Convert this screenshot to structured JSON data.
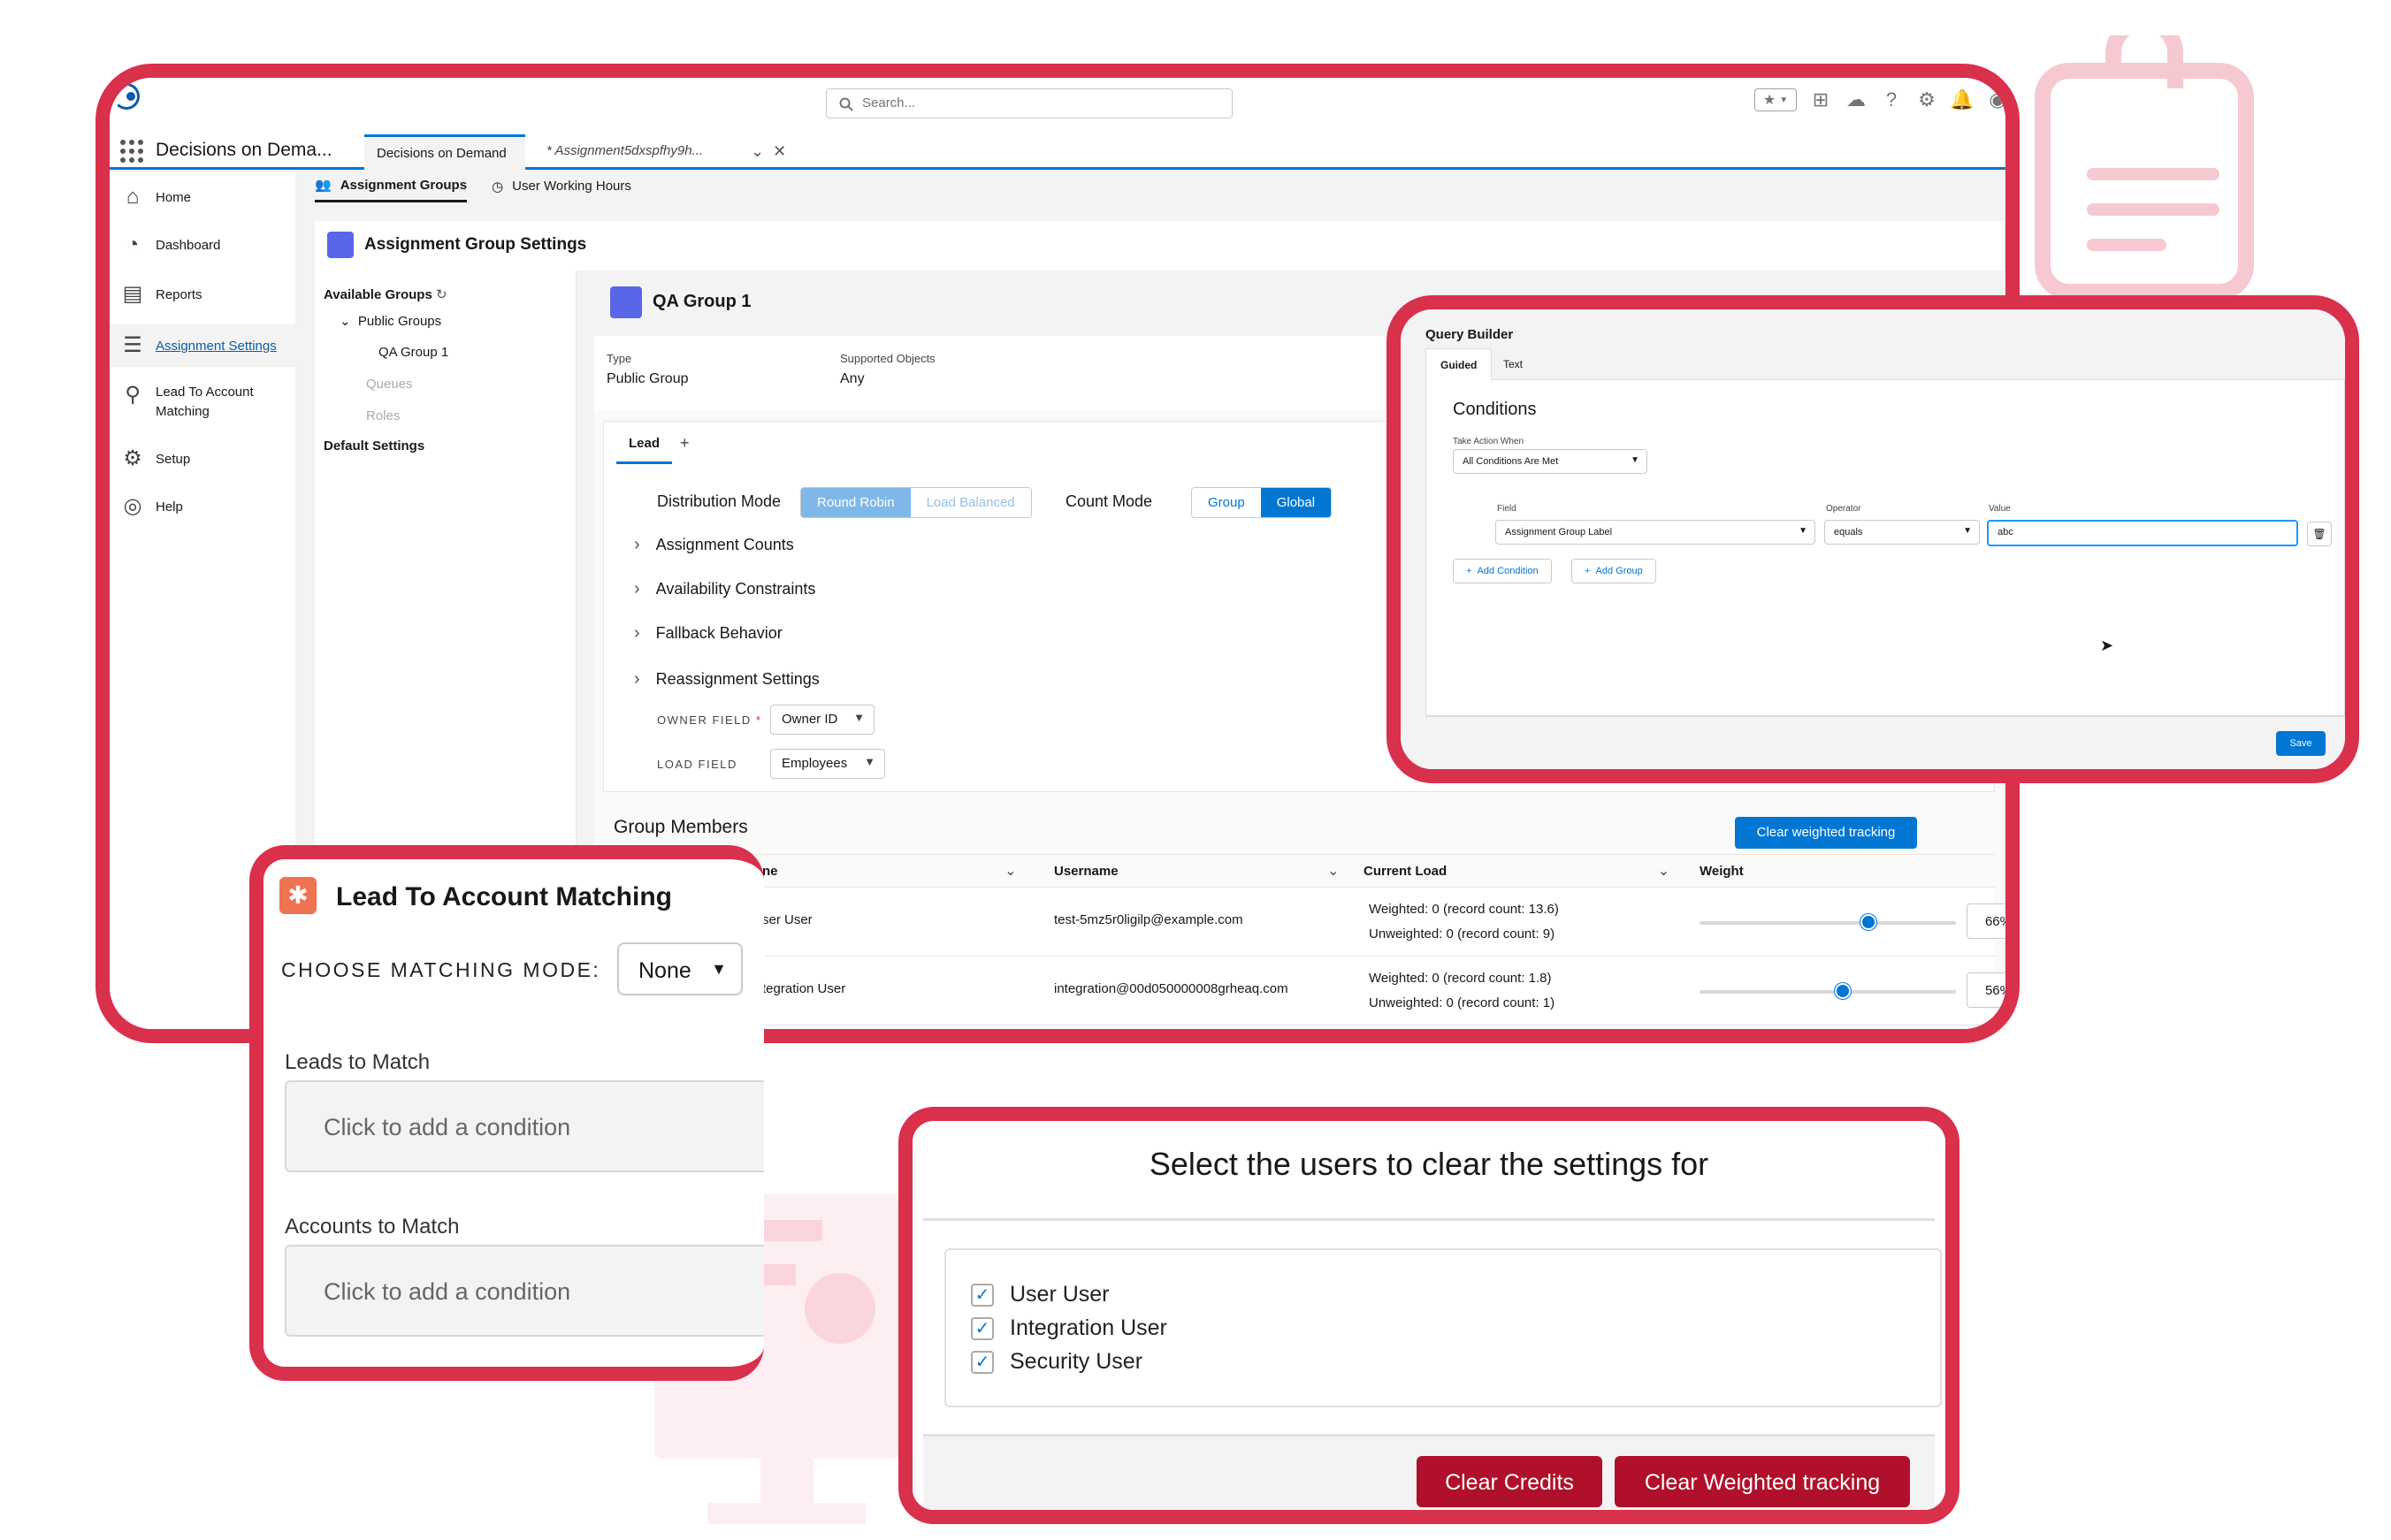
{
  "main": {
    "search_placeholder": "Search...",
    "app_name": "Decisions on Dema...",
    "tabs": [
      {
        "label": "Decisions on Demand"
      },
      {
        "label": "* Assignment5dxspfhy9h..."
      }
    ],
    "sidebar": [
      {
        "label": "Home",
        "icon": "home-icon"
      },
      {
        "label": "Dashboard",
        "icon": "dashboard-icon"
      },
      {
        "label": "Reports",
        "icon": "reports-icon"
      },
      {
        "label": "Assignment Settings",
        "icon": "settings-lines-icon"
      },
      {
        "label": "Lead To Account Matching",
        "icon": "person-match-icon"
      },
      {
        "label": "Setup",
        "icon": "gear-icon"
      },
      {
        "label": "Help",
        "icon": "help-icon"
      }
    ],
    "sub_tabs": [
      {
        "label": "Assignment Groups"
      },
      {
        "label": "User Working Hours"
      }
    ],
    "settings_title": "Assignment Group Settings",
    "groups_panel": {
      "available_groups": "Available Groups",
      "public_groups": "Public Groups",
      "qa_group": "QA Group 1",
      "queues": "Queues",
      "roles": "Roles",
      "default_settings": "Default Settings"
    },
    "detail": {
      "group_name": "QA Group 1",
      "type_label": "Type",
      "type_value": "Public Group",
      "objects_label": "Supported Objects",
      "objects_value": "Any",
      "lead_tab": "Lead",
      "plus_tab": "+",
      "distribution_mode_label": "Distribution Mode",
      "round_robin": "Round Robin",
      "load_balanced": "Load Balanced",
      "count_mode_label": "Count Mode",
      "group": "Group",
      "global": "Global",
      "sections": [
        "Assignment Counts",
        "Availability Constraints",
        "Fallback Behavior",
        "Reassignment Settings"
      ],
      "owner_field_label": "OWNER FIELD",
      "owner_field_required": "*",
      "owner_field_value": "Owner ID",
      "load_field_label": "LOAD FIELD",
      "load_field_value": "Employees"
    },
    "members": {
      "title": "Group Members",
      "clear_button": "Clear weighted tracking",
      "columns": [
        "ne",
        "Username",
        "Current Load",
        "Weight"
      ],
      "rows": [
        {
          "name": "ser User",
          "username": "test-5mz5r0ligilp@example.com",
          "weighted": "Weighted: 0 (record count: 13.6)",
          "unweighted": "Unweighted: 0 (record count: 9)",
          "weight": 0.66,
          "weight_label": "66%"
        },
        {
          "name": "tegration User",
          "username": "integration@00d050000008grheaq.com",
          "weighted": "Weighted: 0 (record count: 1.8)",
          "unweighted": "Unweighted: 0 (record count: 1)",
          "weight": 0.56,
          "weight_label": "56%"
        }
      ]
    }
  },
  "query_builder": {
    "title": "Query Builder",
    "tabs": [
      "Guided",
      "Text"
    ],
    "conditions_title": "Conditions",
    "take_action_label": "Take Action When",
    "take_action_value": "All Conditions Are Met",
    "field_label": "Field",
    "field_value": "Assignment Group Label",
    "operator_label": "Operator",
    "operator_value": "equals",
    "value_label": "Value",
    "value_value": "abc",
    "add_condition": "Add Condition",
    "add_group": "Add Group",
    "save": "Save"
  },
  "lead_matching": {
    "title": "Lead To Account Matching",
    "mode_label": "CHOOSE MATCHING MODE:",
    "mode_value": "None",
    "leads_label": "Leads to Match",
    "leads_placeholder": "Click to add a condition",
    "accounts_label": "Accounts to Match",
    "accounts_placeholder": "Click to add a condition"
  },
  "clear_settings": {
    "title": "Select the users to clear the settings for",
    "users": [
      {
        "label": "User User",
        "checked": true
      },
      {
        "label": "Integration User",
        "checked": true
      },
      {
        "label": "Security User",
        "checked": true
      }
    ],
    "clear_credits": "Clear Credits",
    "clear_weighted": "Clear Weighted tracking"
  },
  "colors": {
    "frame": "#d9304c",
    "brand_blue": "#0176d3",
    "danger_button": "#b0102b"
  }
}
